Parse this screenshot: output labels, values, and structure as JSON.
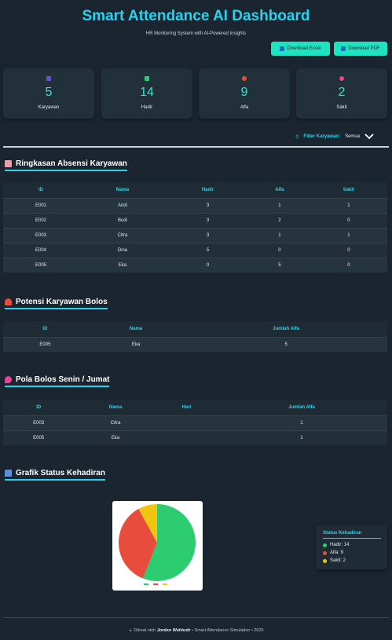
{
  "header": {
    "title": "Smart Attendance AI Dashboard",
    "subtitle": "HR Monitoring System with AI-Powered Insights",
    "download_excel": "Download Excel",
    "download_pdf": "Download PDF"
  },
  "stats": [
    {
      "value": "5",
      "label": "Karyawan",
      "icon": "people-icon",
      "color": "#6b4fd8"
    },
    {
      "value": "14",
      "label": "Hadir",
      "icon": "check-icon",
      "color": "#2ecc71"
    },
    {
      "value": "9",
      "label": "Alfa",
      "icon": "no-entry-icon",
      "color": "#e74c3c"
    },
    {
      "value": "2",
      "label": "Sakit",
      "icon": "pill-icon",
      "color": "#e84393"
    }
  ],
  "filter": {
    "label": "Filter Karyawan:",
    "value": "Semua"
  },
  "summary": {
    "title": "Ringkasan Absensi Karyawan",
    "headers": [
      "ID",
      "Nama",
      "Hadir",
      "Alfa",
      "Sakit"
    ],
    "rows": [
      [
        "E001",
        "Andi",
        "3",
        "1",
        "1"
      ],
      [
        "E002",
        "Budi",
        "3",
        "2",
        "0"
      ],
      [
        "E003",
        "Citra",
        "3",
        "1",
        "1"
      ],
      [
        "E004",
        "Dina",
        "5",
        "0",
        "0"
      ],
      [
        "E005",
        "Eka",
        "0",
        "5",
        "0"
      ]
    ]
  },
  "potential": {
    "title": "Potensi Karyawan Bolos",
    "headers": [
      "ID",
      "Nama",
      "Jumlah Alfa"
    ],
    "rows": [
      [
        "E005",
        "Eka",
        "5"
      ]
    ]
  },
  "pattern": {
    "title": "Pola Bolos Senin / Jumat",
    "headers": [
      "ID",
      "Nama",
      "Hari",
      "Jumlah Alfa"
    ],
    "rows": [
      [
        "E003",
        "Citra",
        "",
        "1"
      ],
      [
        "E005",
        "Eka",
        "",
        "1"
      ]
    ]
  },
  "chart_section": {
    "title": "Grafik Status Kehadiran"
  },
  "chart_data": {
    "type": "pie",
    "categories": [
      "Hadir",
      "Alfa",
      "Sakit"
    ],
    "values": [
      14,
      9,
      2
    ],
    "colors": [
      "#2ecc71",
      "#e74c3c",
      "#f1c40f"
    ]
  },
  "legend": {
    "title": "Status Kehadiran",
    "items": [
      "Hadir: 14",
      "Alfa: 9",
      "Sakit: 2"
    ]
  },
  "footer": {
    "prefix": "Dibuat oleh",
    "author": "Jordan Wahtudz",
    "suffix": "• Smart Attendance Simulation • 2025"
  }
}
